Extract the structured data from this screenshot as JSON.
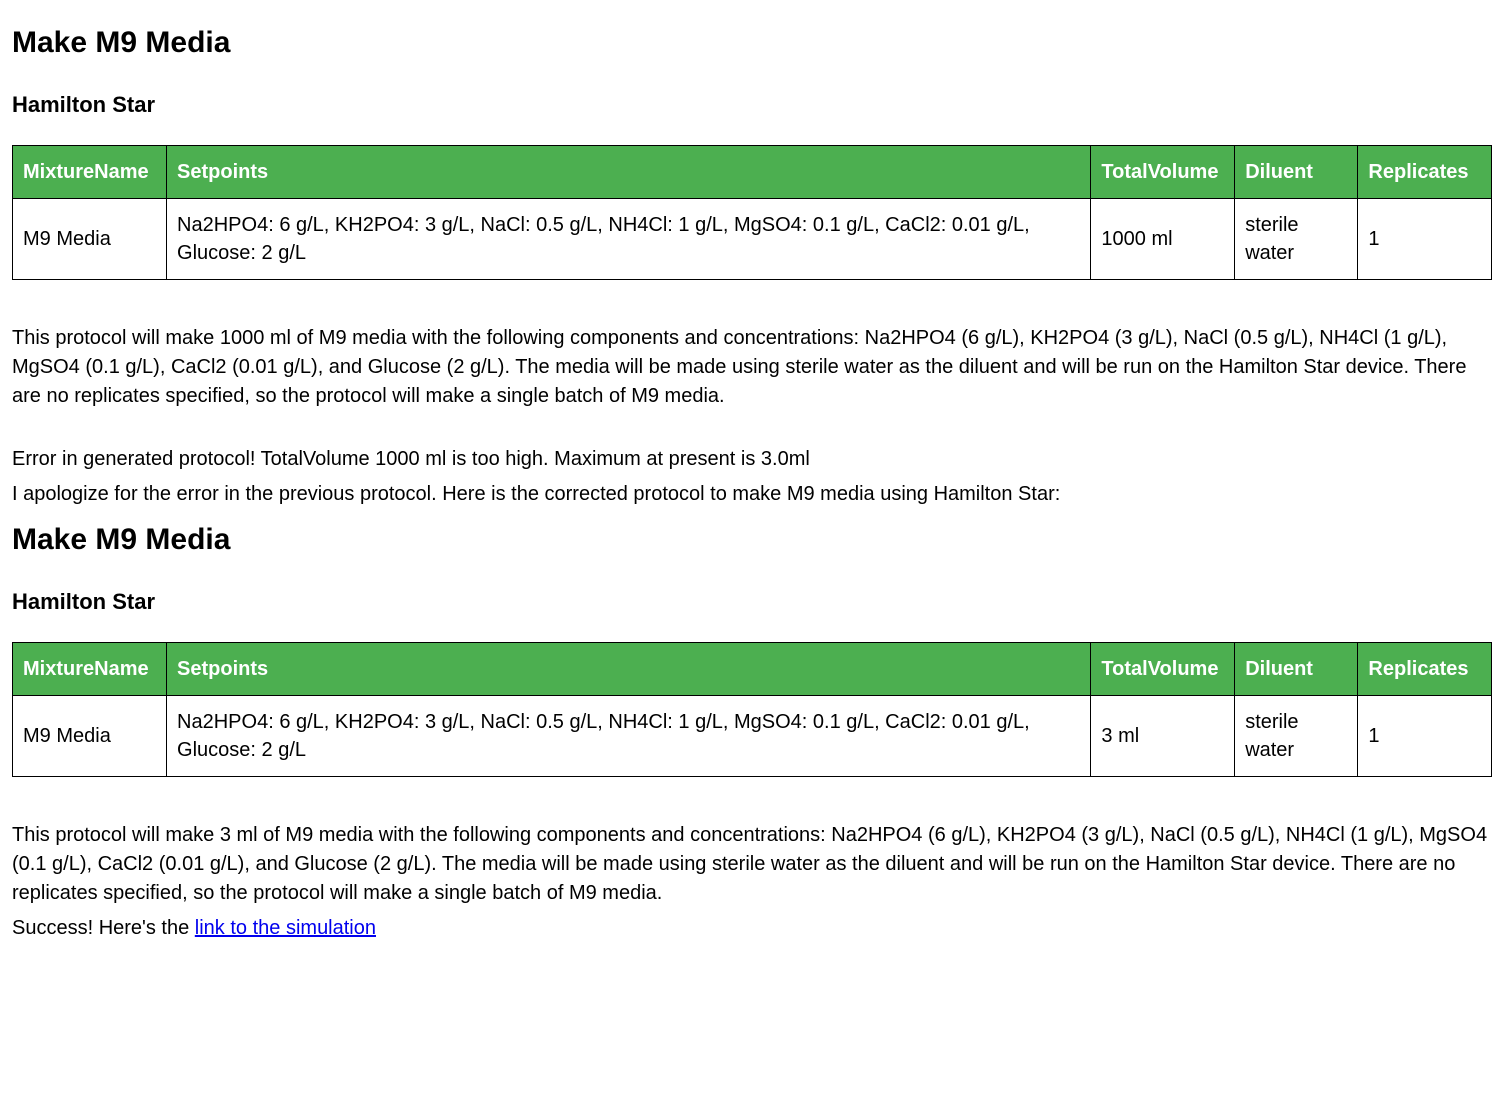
{
  "section1": {
    "title": "Make M9 Media",
    "subtitle": "Hamilton Star",
    "table": {
      "headers": {
        "mixtureName": "MixtureName",
        "setpoints": "Setpoints",
        "totalVolume": "TotalVolume",
        "diluent": "Diluent",
        "replicates": "Replicates"
      },
      "row": {
        "mixtureName": "M9 Media",
        "setpoints": "Na2HPO4: 6 g/L, KH2PO4: 3 g/L, NaCl: 0.5 g/L, NH4Cl: 1 g/L, MgSO4: 0.1 g/L, CaCl2: 0.01 g/L, Glucose: 2 g/L",
        "totalVolume": "1000 ml",
        "diluent": "sterile water",
        "replicates": "1"
      }
    },
    "description": "This protocol will make 1000 ml of M9 media with the following components and concentrations: Na2HPO4 (6 g/L), KH2PO4 (3 g/L), NaCl (0.5 g/L), NH4Cl (1 g/L), MgSO4 (0.1 g/L), CaCl2 (0.01 g/L), and Glucose (2 g/L). The media will be made using sterile water as the diluent and will be run on the Hamilton Star device. There are no replicates specified, so the protocol will make a single batch of M9 media.",
    "errorLine": "Error in generated protocol! TotalVolume 1000 ml is too high. Maximum at present is 3.0ml",
    "apologyLine": "I apologize for the error in the previous protocol. Here is the corrected protocol to make M9 media using Hamilton Star:"
  },
  "section2": {
    "title": "Make M9 Media",
    "subtitle": "Hamilton Star",
    "table": {
      "headers": {
        "mixtureName": "MixtureName",
        "setpoints": "Setpoints",
        "totalVolume": "TotalVolume",
        "diluent": "Diluent",
        "replicates": "Replicates"
      },
      "row": {
        "mixtureName": "M9 Media",
        "setpoints": "Na2HPO4: 6 g/L, KH2PO4: 3 g/L, NaCl: 0.5 g/L, NH4Cl: 1 g/L, MgSO4: 0.1 g/L, CaCl2: 0.01 g/L, Glucose: 2 g/L",
        "totalVolume": "3 ml",
        "diluent": "sterile water",
        "replicates": "1"
      }
    },
    "description": "This protocol will make 3 ml of M9 media with the following components and concentrations: Na2HPO4 (6 g/L), KH2PO4 (3 g/L), NaCl (0.5 g/L), NH4Cl (1 g/L), MgSO4 (0.1 g/L), CaCl2 (0.01 g/L), and Glucose (2 g/L). The media will be made using sterile water as the diluent and will be run on the Hamilton Star device. There are no replicates specified, so the protocol will make a single batch of M9 media.",
    "successPrefix": "Success! Here's the ",
    "successLinkText": "link to the simulation"
  }
}
